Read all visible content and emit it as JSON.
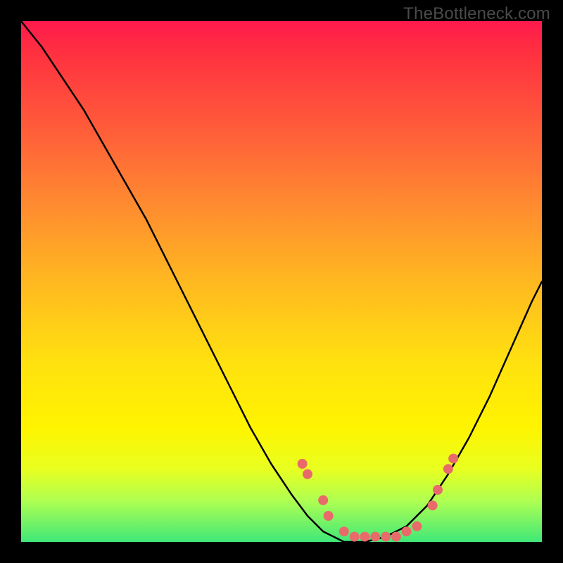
{
  "watermark": "TheBottleneck.com",
  "colors": {
    "background_outer": "#000000",
    "gradient_top": "#ff1a4d",
    "gradient_bottom": "#40e878",
    "curve": "#000000",
    "dots": "#e96a6a"
  },
  "chart_data": {
    "type": "line",
    "title": "",
    "xlabel": "",
    "ylabel": "",
    "xlim": [
      0,
      100
    ],
    "ylim": [
      0,
      100
    ],
    "grid": false,
    "legend": false,
    "description": "Bottleneck curve: a V-shaped line descending from the top-left toward a flat optimum region near x≈55–70, then rising again to the right edge. Red dots mark the optimum band. Higher y means worse (red), lower y means better (green).",
    "series": [
      {
        "name": "bottleneck_curve",
        "x": [
          0,
          4,
          8,
          12,
          16,
          20,
          24,
          28,
          32,
          36,
          40,
          44,
          48,
          52,
          55,
          58,
          62,
          66,
          70,
          74,
          78,
          82,
          86,
          90,
          94,
          98,
          100
        ],
        "y": [
          100,
          95,
          89,
          83,
          76,
          69,
          62,
          54,
          46,
          38,
          30,
          22,
          15,
          9,
          5,
          2,
          0,
          0,
          1,
          3,
          7,
          13,
          20,
          28,
          37,
          46,
          50
        ]
      }
    ],
    "dots": [
      {
        "x": 54,
        "y": 15
      },
      {
        "x": 55,
        "y": 13
      },
      {
        "x": 58,
        "y": 8
      },
      {
        "x": 59,
        "y": 5
      },
      {
        "x": 62,
        "y": 2
      },
      {
        "x": 64,
        "y": 1
      },
      {
        "x": 66,
        "y": 1
      },
      {
        "x": 68,
        "y": 1
      },
      {
        "x": 70,
        "y": 1
      },
      {
        "x": 72,
        "y": 1
      },
      {
        "x": 74,
        "y": 2
      },
      {
        "x": 76,
        "y": 3
      },
      {
        "x": 79,
        "y": 7
      },
      {
        "x": 80,
        "y": 10
      },
      {
        "x": 82,
        "y": 14
      },
      {
        "x": 83,
        "y": 16
      }
    ]
  }
}
